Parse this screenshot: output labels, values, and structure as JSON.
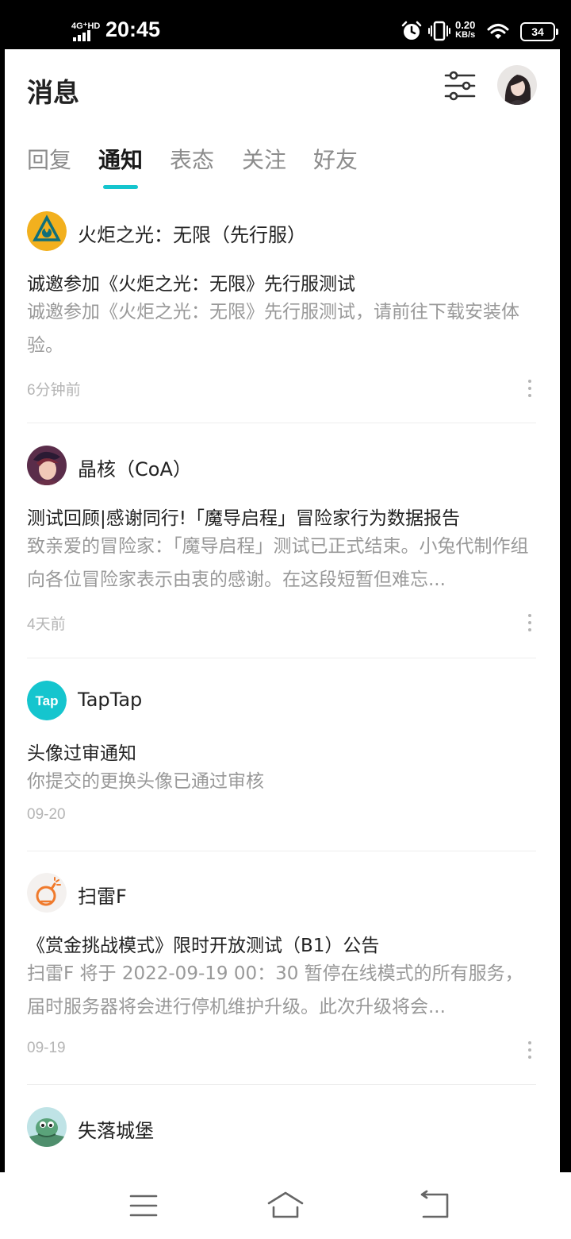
{
  "status_bar": {
    "network": "4G⁺HD",
    "time": "20:45",
    "speed_value": "0.20",
    "speed_unit": "KB/s",
    "battery": "34"
  },
  "header": {
    "title": "消息",
    "filter_icon": "sliders-icon",
    "avatar": "user-avatar"
  },
  "tabs": [
    {
      "label": "回复",
      "active": false
    },
    {
      "label": "通知",
      "active": true
    },
    {
      "label": "表态",
      "active": false
    },
    {
      "label": "关注",
      "active": false
    },
    {
      "label": "好友",
      "active": false
    }
  ],
  "accent_color": "#15c5ce",
  "notifications": [
    {
      "sender": "火炬之光：无限（先行服）",
      "title": "诚邀参加《火炬之光：无限》先行服测试",
      "body": "诚邀参加《火炬之光：无限》先行服测试，请前往下载安装体验。",
      "time": "6分钟前",
      "icon": "torchlight-game-icon"
    },
    {
      "sender": "晶核（CoA）",
      "title": "测试回顾|感谢同行!「魔导启程」冒险家行为数据报告",
      "body": "致亲爱的冒险家：「魔导启程」测试已正式结束。小兔代制作组向各位冒险家表示由衷的感谢。在这段短暂但难忘...",
      "time": "4天前",
      "icon": "coa-game-icon"
    },
    {
      "sender": "TapTap",
      "title": "头像过审通知",
      "body": "你提交的更换头像已通过审核",
      "time": "09-20",
      "icon": "taptap-logo-icon"
    },
    {
      "sender": "扫雷F",
      "title": "《赏金挑战模式》限时开放测试（B1）公告",
      "body": "扫雷F 将于 2022-09-19 00：30 暂停在线模式的所有服务，届时服务器将会进行停机维护升级。此次升级将会...",
      "time": "09-19",
      "icon": "minesweeper-bomb-icon"
    },
    {
      "sender": "失落城堡",
      "icon": "lost-castle-game-icon"
    }
  ],
  "nav": {
    "menu_icon": "menu-icon",
    "home_icon": "home-icon",
    "back_icon": "back-icon"
  }
}
